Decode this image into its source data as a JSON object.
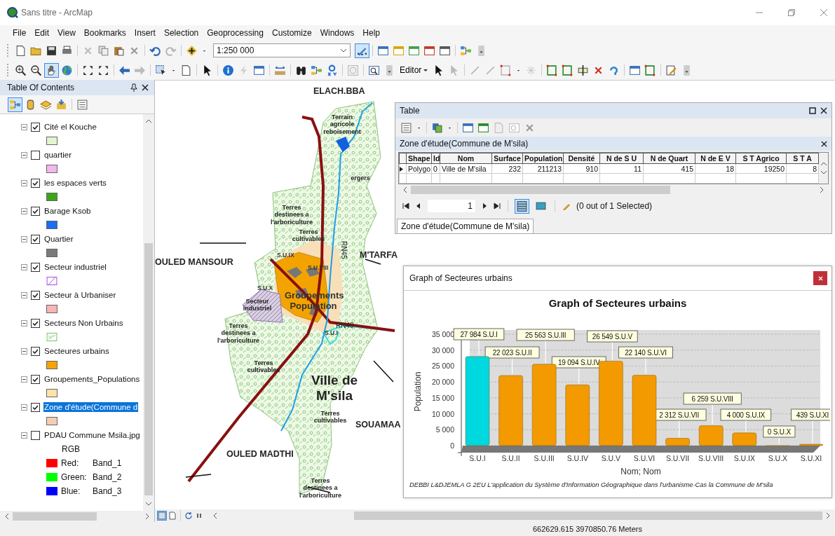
{
  "window": {
    "title": "Sans titre - ArcMap"
  },
  "menu": [
    "File",
    "Edit",
    "View",
    "Bookmarks",
    "Insert",
    "Selection",
    "Geoprocessing",
    "Customize",
    "Windows",
    "Help"
  ],
  "standard_toolbar": {
    "scale": "1:250 000"
  },
  "tools_toolbar": {
    "editor_menu": "Editor"
  },
  "toc": {
    "title": "Table Of Contents",
    "layers": [
      {
        "name": "Cité el Kouche",
        "checked": true,
        "expanded": true,
        "selected": false,
        "kind": "fill",
        "color": "#e2f5d0"
      },
      {
        "name": "quartier",
        "checked": false,
        "expanded": true,
        "selected": false,
        "kind": "fill",
        "color": "#f0b8ee"
      },
      {
        "name": "les espaces verts",
        "checked": true,
        "expanded": true,
        "selected": false,
        "kind": "fill",
        "color": "#3aa617"
      },
      {
        "name": "Barage Ksob",
        "checked": true,
        "expanded": true,
        "selected": false,
        "kind": "fill",
        "color": "#1a6ef5"
      },
      {
        "name": "Quartier",
        "checked": true,
        "expanded": true,
        "selected": false,
        "kind": "fill",
        "color": "#7a7a7a"
      },
      {
        "name": "Secteur industriel",
        "checked": true,
        "expanded": true,
        "selected": false,
        "kind": "hatch",
        "color": "#a040e0"
      },
      {
        "name": "Secteur à Urbaniser",
        "checked": true,
        "expanded": true,
        "selected": false,
        "kind": "fill",
        "color": "#f7b5b5"
      },
      {
        "name": "Secteurs Non Urbains",
        "checked": true,
        "expanded": true,
        "selected": false,
        "kind": "pattern",
        "color": "#6cbf5a"
      },
      {
        "name": "Secteures urbains",
        "checked": true,
        "expanded": true,
        "selected": false,
        "kind": "fill",
        "color": "#f5a300"
      },
      {
        "name": "Groupements_Populations",
        "checked": true,
        "expanded": true,
        "selected": false,
        "kind": "fill",
        "color": "#fde3a8"
      },
      {
        "name": "Zone d'étude(Commune d",
        "checked": true,
        "expanded": true,
        "selected": true,
        "kind": "fill",
        "color": "#f5cdb5"
      },
      {
        "name": "PDAU Commune Msila.jpg",
        "checked": false,
        "expanded": true,
        "selected": false,
        "kind": "raster",
        "renderer": "RGB",
        "bands": [
          {
            "label": "Red:",
            "band": "Band_1",
            "color": "#ff0000"
          },
          {
            "label": "Green:",
            "band": "Band_2",
            "color": "#00ff00"
          },
          {
            "label": "Blue:",
            "band": "Band_3",
            "color": "#0000ff"
          }
        ]
      }
    ]
  },
  "map": {
    "labels": [
      {
        "text": "ELACH.BBA",
        "kind": "place"
      },
      {
        "text": "Terrain agricole reboisement",
        "kind": "zone"
      },
      {
        "text": "ergers",
        "kind": "zone"
      },
      {
        "text": "Terres destinees a l'arboriculture",
        "kind": "zone"
      },
      {
        "text": "Terres cultivables",
        "kind": "zone"
      },
      {
        "text": "RN45",
        "kind": "road"
      },
      {
        "text": "OULED MANSOUR",
        "kind": "place"
      },
      {
        "text": "M'TARFA",
        "kind": "place"
      },
      {
        "text": "S.U.IX",
        "kind": "sector"
      },
      {
        "text": "S.U.VIII",
        "kind": "sector"
      },
      {
        "text": "S.U.X",
        "kind": "sector"
      },
      {
        "text": "Secteur industriel",
        "kind": "zone"
      },
      {
        "text": "Groupements Population",
        "kind": "group"
      },
      {
        "text": "RN40",
        "kind": "road"
      },
      {
        "text": "S.U.I",
        "kind": "sector"
      },
      {
        "text": "Terres destinees a l'arboriculture",
        "kind": "zone"
      },
      {
        "text": "Terres cultivables",
        "kind": "zone"
      },
      {
        "text": "Ville de M'sila",
        "kind": "city"
      },
      {
        "text": "Terres cultivables",
        "kind": "zone"
      },
      {
        "text": "SOUAMAA",
        "kind": "place"
      },
      {
        "text": "OULED MADTHI",
        "kind": "place"
      },
      {
        "text": "Terres destinees a l'arboriculture",
        "kind": "zone"
      }
    ]
  },
  "table_window": {
    "title": "Table",
    "tab_title": "Zone d'étude(Commune de M'sila)",
    "columns": [
      "Shape",
      "Id",
      "Nom",
      "Surface",
      "Population",
      "Densité",
      "N de S U",
      "N de Quart",
      "N de E V",
      "S T Agrico",
      "S T A"
    ],
    "rows": [
      [
        "Polygo",
        "0",
        "Ville de M'sila",
        "232",
        "211213",
        "910",
        "11",
        "415",
        "18",
        "19250",
        "8"
      ]
    ],
    "record": "1",
    "selection_status": "(0 out of 1 Selected)",
    "bottom_tab": "Zone d'étude(Commune de M'sila)"
  },
  "graph_window": {
    "title": "Graph of Secteures urbains",
    "chart_data": {
      "type": "bar",
      "title": "Graph of Secteures urbains",
      "xlabel": "Nom; Nom",
      "ylabel": "Population",
      "categories": [
        "S.U.I",
        "S.U.II",
        "S.U.III",
        "S.U.IV",
        "S.U.V",
        "S.U.VI",
        "S.U.VII",
        "S.U.VIII",
        "S.U.IX",
        "S.U.X",
        "S.U.XI"
      ],
      "series": [
        {
          "colors": [
            "#00d8e0",
            "#f29a00",
            "#f29a00",
            "#f29a00",
            "#f29a00",
            "#f29a00",
            "#f29a00",
            "#f29a00",
            "#f29a00",
            "#f29a00",
            "#f29a00"
          ],
          "values": [
            27984,
            22023,
            25563,
            19094,
            26549,
            22140,
            2312,
            6259,
            4000,
            0,
            439
          ]
        }
      ],
      "grid": true,
      "ylim": [
        0,
        35000
      ],
      "yticks": [
        {
          "value": 0,
          "label": "0"
        },
        {
          "value": 5000,
          "label": "5 000"
        },
        {
          "value": 10000,
          "label": "10 000"
        },
        {
          "value": 15000,
          "label": "15 000"
        },
        {
          "value": 20000,
          "label": "20 000"
        },
        {
          "value": 25000,
          "label": "25 000"
        },
        {
          "value": 30000,
          "label": "30 000"
        },
        {
          "value": 35000,
          "label": "35 000"
        }
      ],
      "value_labels": [
        "27 984 S.U.I",
        "22 023 S.U.II",
        "25 563 S.U.III",
        "19 094 S.U.IV",
        "26 549 S.U.V",
        "22 140 S.U.VI",
        "2 312 S.U.VII",
        "6 259 S.U.VIII",
        "4 000 S.U.IX",
        "0 S.U.X",
        "439 S.U.XI"
      ]
    },
    "footer": "DEBBI L&DJEMLA G 2EU   L'application du Système d'Information Géographique dans l'urbanisme-Cas la Commune de M'sila"
  },
  "status_bar": {
    "coordinates": "662629.615  3970850.76 Meters"
  }
}
